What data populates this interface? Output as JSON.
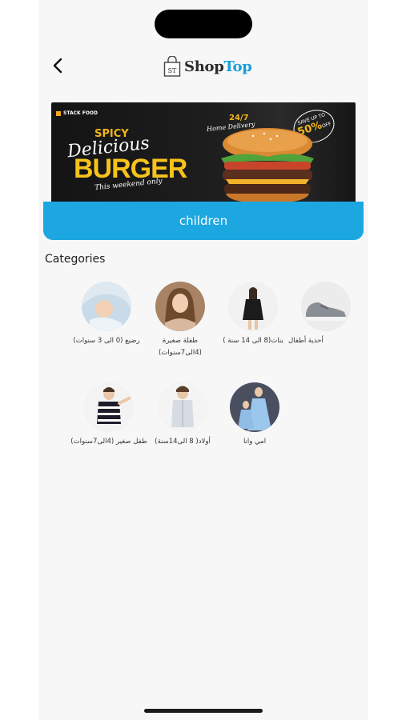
{
  "header": {
    "logo_part1": "Shop",
    "logo_part2": "Top",
    "logo_mark": "ST"
  },
  "banner": {
    "brand": "STACK FOOD",
    "spicy": "SPICY",
    "delicious": "Delicious",
    "burger": "BURGER",
    "weekend": "This weekend only",
    "hours": "24/7",
    "home_delivery": "Home Delivery",
    "save_top": "SAVE UP TO",
    "save_pct": "50%",
    "save_off": "OFF"
  },
  "category_bar": {
    "title": "children"
  },
  "section": {
    "title": "Categories"
  },
  "categories": [
    {
      "label": "رضيع (0 الى 3 سنوات)",
      "icon": "baby-photo"
    },
    {
      "label": "طفلة صغيرة (4الى7سنوات)",
      "icon": "little-girl-photo"
    },
    {
      "label": "بنات(8 الى 14 سنة )",
      "icon": "girl-photo"
    },
    {
      "label": "أحذية أطفال",
      "icon": "kids-shoe-photo"
    },
    {
      "label": "طفل صغير (4الى7سنوات)",
      "icon": "little-boy-photo"
    },
    {
      "label": "أولاد( 8 الى14سنة)",
      "icon": "boy-photo"
    },
    {
      "label": "امي وانا",
      "icon": "mom-and-me-photo"
    }
  ]
}
